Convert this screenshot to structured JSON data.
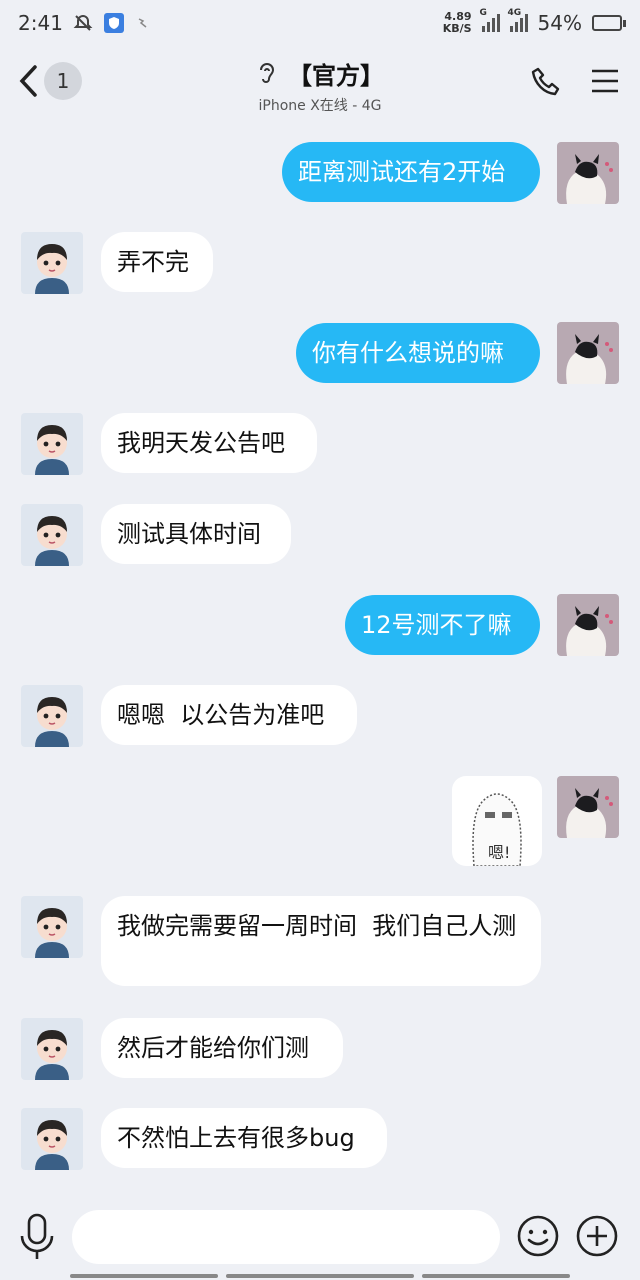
{
  "status_bar": {
    "time": "2:41",
    "speed_value": "4.89",
    "speed_unit": "KB/S",
    "signal1_tag": "G",
    "signal2_tag": "4G",
    "battery": "54%",
    "battery_level": 0.54
  },
  "header": {
    "unread_count": "1",
    "title": "【官方】",
    "subtitle": "iPhone X在线 - 4G"
  },
  "messages": [
    {
      "side": "out",
      "text": "距离测试还有2开始"
    },
    {
      "side": "in",
      "text": "弄不完"
    },
    {
      "side": "out",
      "text": "你有什么想说的嘛"
    },
    {
      "side": "in",
      "text": "我明天发公告吧"
    },
    {
      "side": "in",
      "text": "测试具体时间"
    },
    {
      "side": "out",
      "text": "12号测不了嘛"
    },
    {
      "side": "in",
      "text": "嗯嗯  以公告为准吧"
    },
    {
      "side": "out",
      "type": "sticker",
      "sticker_text": "嗯!"
    },
    {
      "side": "in",
      "text": "我做完需要留一周时间  我们自己人测"
    },
    {
      "side": "in",
      "text": "然后才能给你们测"
    },
    {
      "side": "in",
      "text": "不然怕上去有很多bug"
    }
  ],
  "input": {
    "value": "",
    "placeholder": ""
  },
  "colors": {
    "accent": "#26b8f5",
    "background": "#eef0f5",
    "bubble_in": "#ffffff"
  }
}
